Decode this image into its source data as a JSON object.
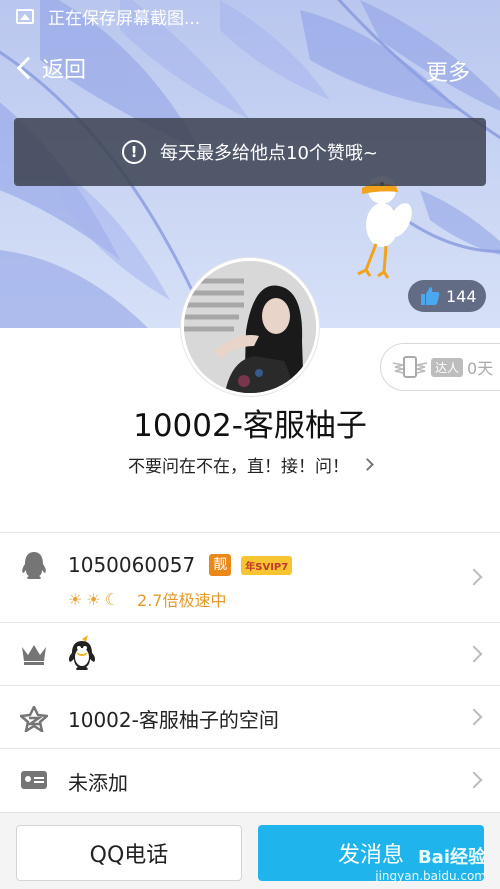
{
  "status_bar": {
    "text": "正在保存屏幕截图..."
  },
  "nav": {
    "back_label": "返回",
    "more_label": "更多"
  },
  "toast": {
    "text": "每天最多给他点10个赞哦~"
  },
  "likes": {
    "count": "144"
  },
  "talent": {
    "badge": "达人",
    "days": "0天"
  },
  "profile": {
    "name": "10002-客服柚子",
    "signature": "不要问在不在，直！接！问！"
  },
  "account_row": {
    "qq_number": "1050060057",
    "liang_badge": "靓",
    "svip_badge": "年SVIP7",
    "speed_text": "2.7倍极速中"
  },
  "list_rows": [
    {
      "label": "",
      "icon": "crown-icon"
    },
    {
      "label": "10002-客服柚子的空间",
      "icon": "qzone-star-icon"
    },
    {
      "label": "未添加",
      "icon": "id-card-icon"
    }
  ],
  "actions": {
    "call_label": "QQ电话",
    "message_label": "发消息"
  },
  "watermark": {
    "brand": "Bai经验",
    "url": "jingyan.baidu.com"
  },
  "colors": {
    "accent": "#1fb5ec",
    "vip_orange": "#e8891a",
    "level_gold": "#e8a23a"
  }
}
